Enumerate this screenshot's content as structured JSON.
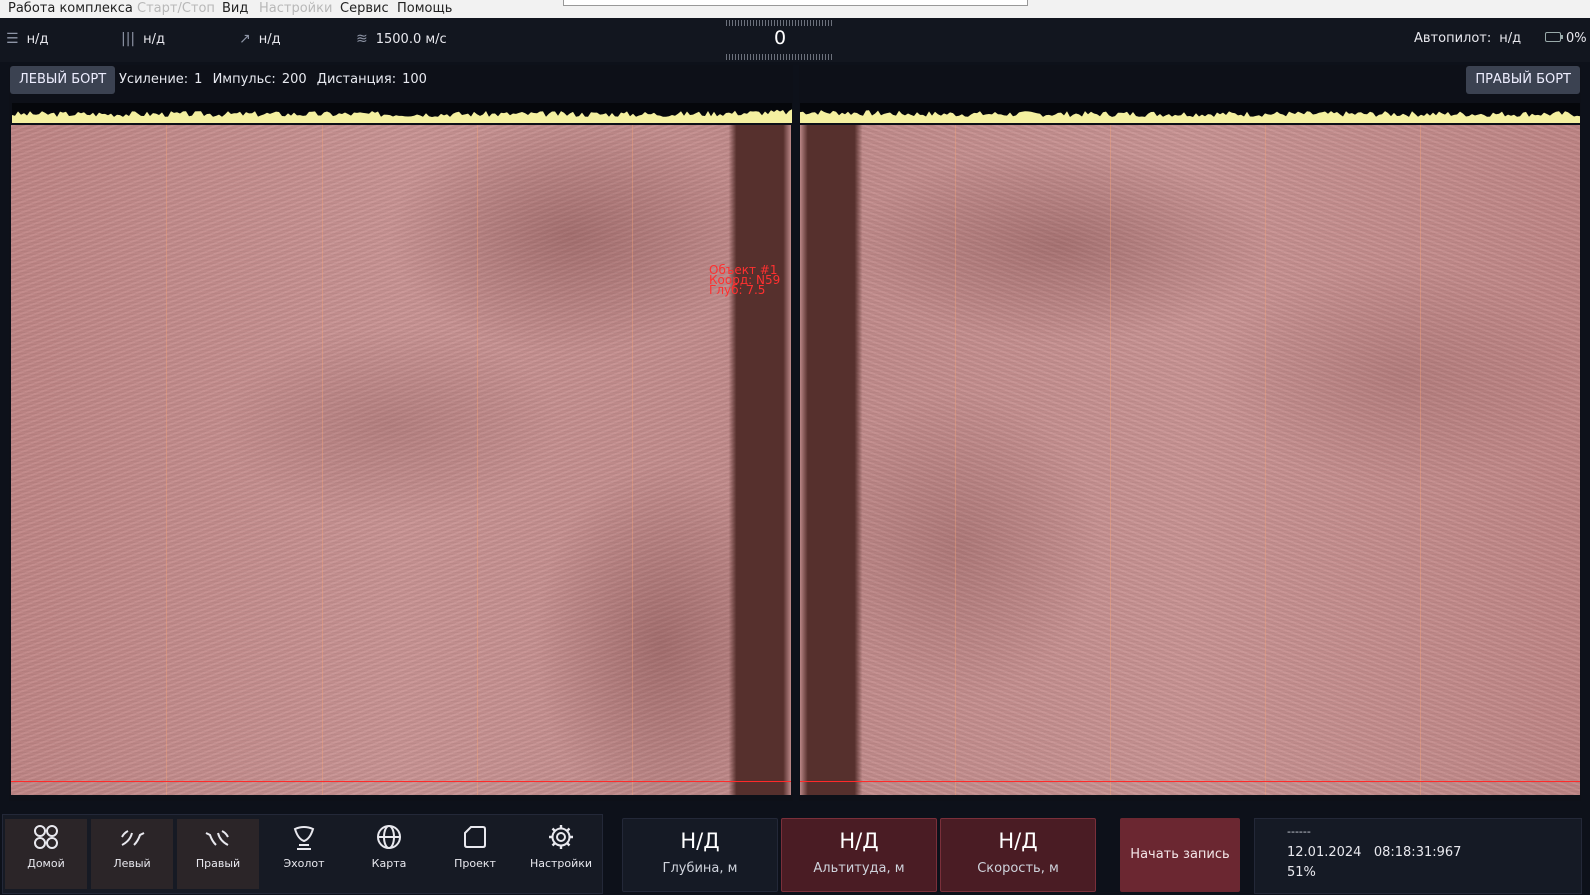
{
  "menu": {
    "items": [
      {
        "label": "Работа комплекса",
        "enabled": true
      },
      {
        "label": "Старт/Стоп",
        "enabled": false
      },
      {
        "label": "Вид",
        "enabled": true
      },
      {
        "label": "Настройки",
        "enabled": false
      },
      {
        "label": "Сервис",
        "enabled": true
      },
      {
        "label": "Помощь",
        "enabled": true
      }
    ]
  },
  "status": {
    "menu_value": "н/д",
    "bars_value": "н/д",
    "arrow_value": "н/д",
    "sound_speed": "1500.0 м/с",
    "heading": "0",
    "autopilot_label": "Автопилот:",
    "autopilot_value": "н/д",
    "battery": "0%"
  },
  "left_panel": {
    "side_label": "ЛЕВЫЙ БОРТ",
    "gain_label": "Усиление:",
    "gain_value": "1",
    "pulse_label": "Импульс:",
    "pulse_value": "200",
    "distance_label": "Дистанция:",
    "distance_value": "100"
  },
  "right_panel": {
    "side_label": "ПРАВЫЙ БОРТ"
  },
  "markers": {
    "object1": [
      "Объект #1",
      "Коорд: N59",
      "Глуб: 7.5"
    ]
  },
  "nav": {
    "items": [
      {
        "label": "Домой",
        "icon": "grid-icon"
      },
      {
        "label": "Левый",
        "icon": "left-sonar-icon"
      },
      {
        "label": "Правый",
        "icon": "right-sonar-icon"
      },
      {
        "label": "Эхолот",
        "icon": "echosounder-icon"
      },
      {
        "label": "Карта",
        "icon": "globe-icon"
      },
      {
        "label": "Проект",
        "icon": "folder-icon"
      },
      {
        "label": "Настройки",
        "icon": "gear-icon"
      }
    ]
  },
  "readouts": {
    "depth": {
      "value": "Н/Д",
      "label": "Глубина, м"
    },
    "altitude": {
      "value": "Н/Д",
      "label": "Альтитуда, м"
    },
    "speed": {
      "value": "Н/Д",
      "label": "Скорость, м"
    }
  },
  "record_button": "Начать запись",
  "info": {
    "line1": "------",
    "date": "12.01.2024",
    "time": "08:18:31:967",
    "percent": "51%"
  },
  "colors": {
    "accent_alert": "#4a1c24",
    "record": "#6b2731",
    "sonar_tint": "#c48c8c",
    "marker_red": "#ff3030"
  }
}
